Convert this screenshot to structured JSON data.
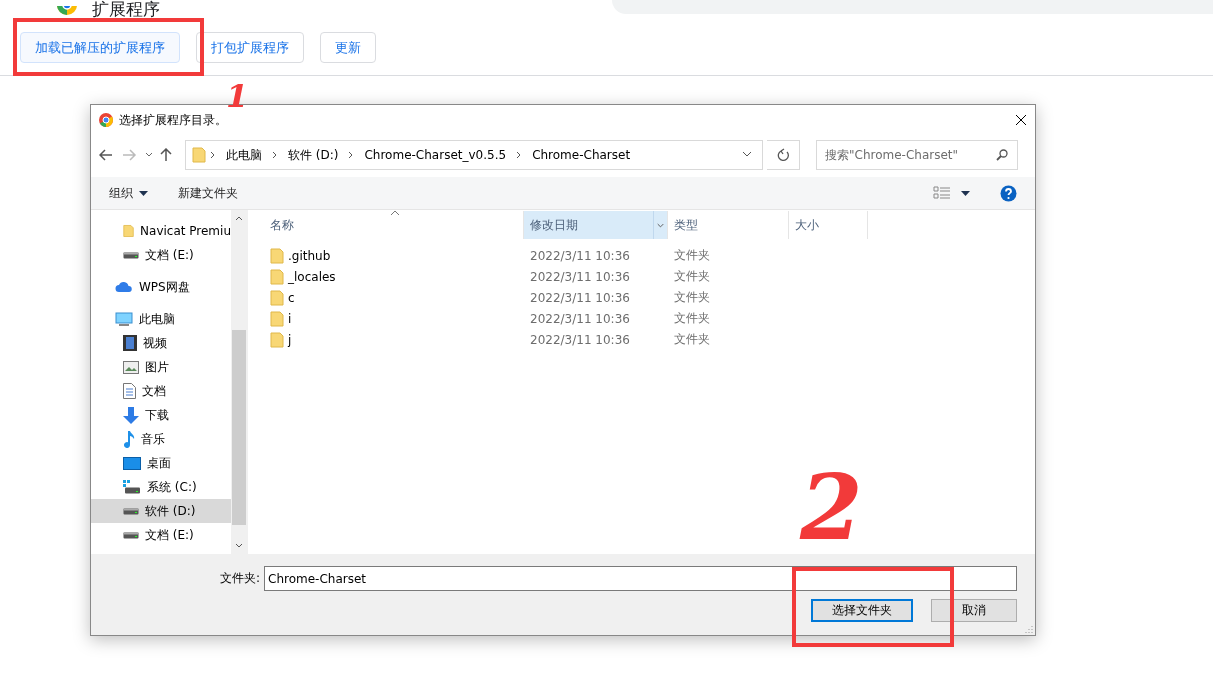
{
  "page": {
    "title": "扩展程序",
    "buttons": [
      {
        "label": "加载已解压的扩展程序",
        "selected": true
      },
      {
        "label": "打包扩展程序",
        "selected": false
      },
      {
        "label": "更新",
        "selected": false
      }
    ]
  },
  "dialog": {
    "title": "选择扩展程序目录。",
    "breadcrumbs": [
      "此电脑",
      "软件 (D:)",
      "Chrome-Charset_v0.5.5",
      "Chrome-Charset"
    ],
    "search": {
      "placeholder": "搜索\"Chrome-Charset\""
    },
    "commands": [
      "组织",
      "新建文件夹"
    ],
    "nav": [
      {
        "kind": "group",
        "children": [
          {
            "label": "Navicat Premiu",
            "kind": "folder",
            "selected": false
          },
          {
            "label": "文档 (E:)",
            "kind": "drive",
            "selected": false
          }
        ]
      },
      {
        "label": "WPS网盘",
        "kind": "cloud",
        "selected": false
      },
      {
        "label": "此电脑",
        "kind": "pc",
        "selected": false,
        "children": [
          {
            "label": "视频",
            "kind": "video",
            "selected": false
          },
          {
            "label": "图片",
            "kind": "image",
            "selected": false
          },
          {
            "label": "文档",
            "kind": "doc",
            "selected": false
          },
          {
            "label": "下载",
            "kind": "download",
            "selected": false
          },
          {
            "label": "音乐",
            "kind": "music",
            "selected": false
          },
          {
            "label": "桌面",
            "kind": "desktop",
            "selected": false
          },
          {
            "label": "系统 (C:)",
            "kind": "sysdrive",
            "selected": false
          },
          {
            "label": "软件 (D:)",
            "kind": "drive",
            "selected": true
          },
          {
            "label": "文档 (E:)",
            "kind": "drive",
            "selected": false
          }
        ]
      }
    ],
    "columns": [
      {
        "label": "名称",
        "sorted": true,
        "highlighted": false
      },
      {
        "label": "修改日期",
        "sorted": false,
        "highlighted": true
      },
      {
        "label": "类型",
        "sorted": false,
        "highlighted": false
      },
      {
        "label": "大小",
        "sorted": false,
        "highlighted": false
      }
    ],
    "rows": [
      {
        "name": ".github",
        "date": "2022/3/11 10:36",
        "type": "文件夹"
      },
      {
        "name": "_locales",
        "date": "2022/3/11 10:36",
        "type": "文件夹"
      },
      {
        "name": "c",
        "date": "2022/3/11 10:36",
        "type": "文件夹"
      },
      {
        "name": "i",
        "date": "2022/3/11 10:36",
        "type": "文件夹"
      },
      {
        "name": "j",
        "date": "2022/3/11 10:36",
        "type": "文件夹"
      }
    ],
    "folder_label": "文件夹:",
    "folder_value": "Chrome-Charset",
    "buttons": [
      {
        "label": "选择文件夹",
        "default": true
      },
      {
        "label": "取消",
        "default": false
      }
    ]
  },
  "annotations": [
    {
      "kind": "box"
    },
    {
      "kind": "box"
    },
    {
      "kind": "number",
      "label": "1"
    },
    {
      "kind": "number",
      "label": "2"
    }
  ]
}
